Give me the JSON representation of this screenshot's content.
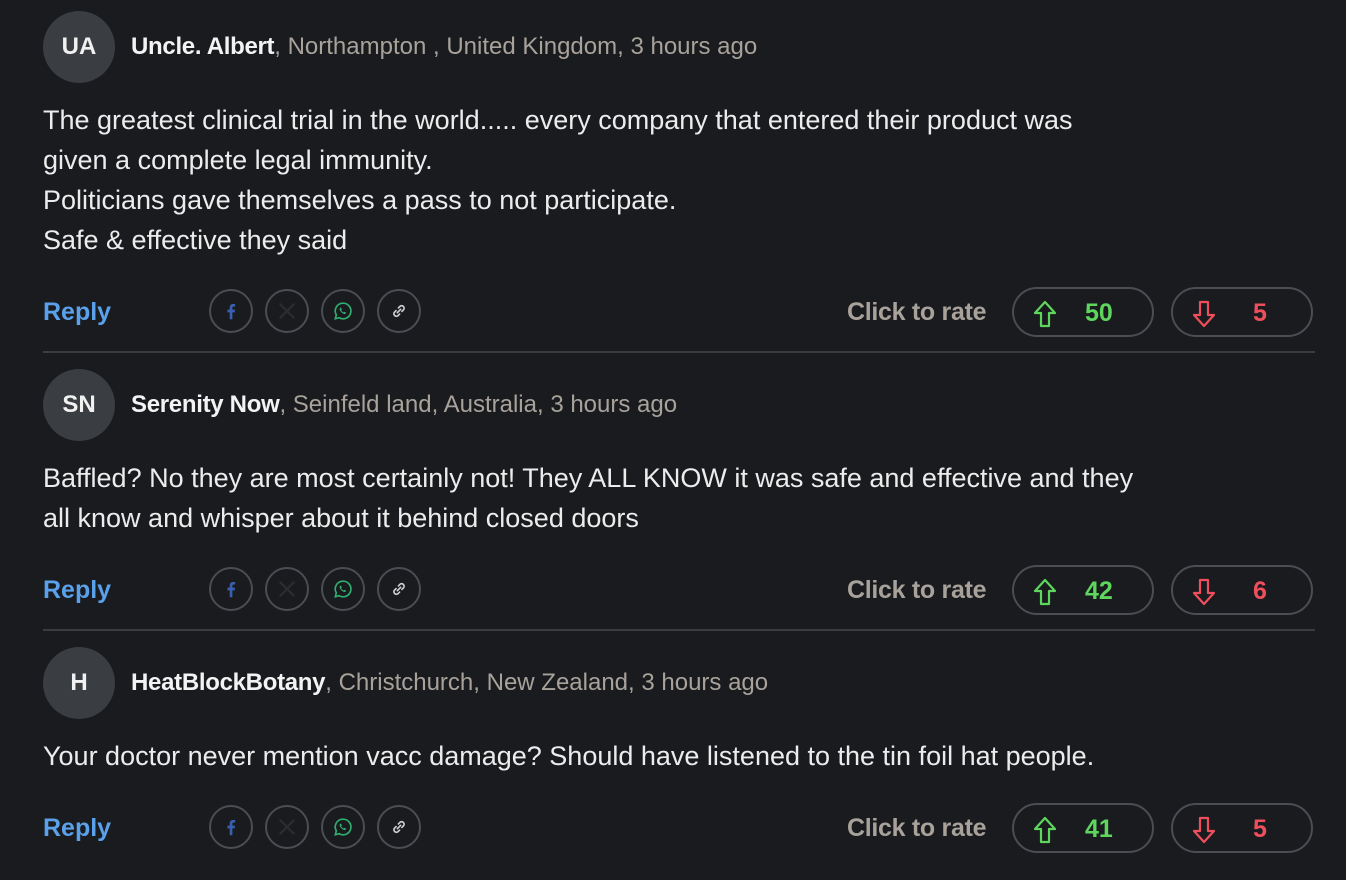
{
  "colors": {
    "background": "#191b1e",
    "reply": "#5aa0ea",
    "upvote": "#5ed65e",
    "downvote": "#ef4f5d",
    "meta": "#a8a29b",
    "facebook": "#3b5fb0",
    "whatsapp": "#2fae70"
  },
  "icons": {
    "share": [
      "facebook-icon",
      "x-icon",
      "whatsapp-icon",
      "link-icon"
    ],
    "upvote": "arrow-up-icon",
    "downvote": "arrow-down-icon"
  },
  "comments": [
    {
      "initials": "UA",
      "author": "Uncle. Albert",
      "location": "Northampton , United Kingdom",
      "time": "3 hours ago",
      "body": [
        "The greatest clinical trial in the world..... every company that entered their product was",
        "given a complete legal immunity.",
        "Politicians gave themselves a pass to not participate.",
        "Safe & effective they said"
      ],
      "reply_label": "Reply",
      "rate_label": "Click to rate",
      "upvotes": "50",
      "downvotes": "5"
    },
    {
      "initials": "SN",
      "author": "Serenity Now",
      "location": "Seinfeld land, Australia",
      "time": "3 hours ago",
      "body": [
        "Baffled? No they are most certainly not! They ALL KNOW it was safe and effective and they",
        "all know and whisper about it behind closed doors"
      ],
      "reply_label": "Reply",
      "rate_label": "Click to rate",
      "upvotes": "42",
      "downvotes": "6"
    },
    {
      "initials": "H",
      "author": "HeatBlockBotany",
      "location": "Christchurch, New Zealand",
      "time": "3 hours ago",
      "body": [
        "Your doctor never mention vacc damage? Should have listened to the tin foil hat people."
      ],
      "reply_label": "Reply",
      "rate_label": "Click to rate",
      "upvotes": "41",
      "downvotes": "5"
    }
  ]
}
